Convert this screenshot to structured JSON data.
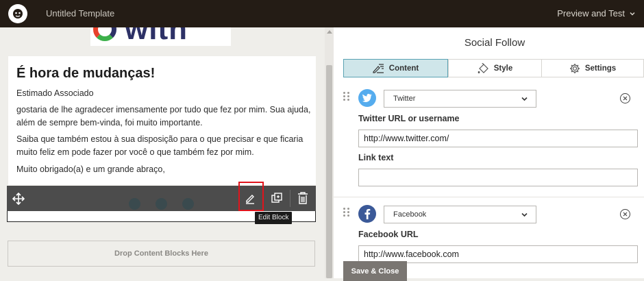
{
  "topbar": {
    "title": "Untitled Template",
    "preview_label": "Preview and Test"
  },
  "email": {
    "banner_text": "with",
    "heading": "É hora de mudanças!",
    "paragraphs": [
      "Estimado Associado",
      "gostaria de lhe agradecer imensamente por tudo que fez por mim. Sua ajuda, além de sempre bem-vinda, foi muito importante.",
      "Saiba que também estou à sua disposição para o que precisar e que ficaria muito feliz em pode fazer por você o que também fez por mim.",
      "Muito obrigado(a) e um grande abraço,"
    ],
    "tooltip": "Edit Block",
    "drop_zone": "Drop Content Blocks Here"
  },
  "panel": {
    "title": "Social Follow",
    "tabs": [
      {
        "label": "Content",
        "icon": "pencil-lines-icon",
        "active": true
      },
      {
        "label": "Style",
        "icon": "paint-bucket-icon",
        "active": false
      },
      {
        "label": "Settings",
        "icon": "gear-icon",
        "active": false
      }
    ],
    "items": [
      {
        "network": "Twitter",
        "icon": "twitter-bird-icon",
        "color": "#55acee",
        "url_label": "Twitter URL or username",
        "url_value": "http://www.twitter.com/",
        "link_label": "Link text",
        "link_value": ""
      },
      {
        "network": "Facebook",
        "icon": "facebook-f-icon",
        "color": "#3b5998",
        "url_label": "Facebook URL",
        "url_value": "http://www.facebook.com"
      }
    ],
    "save_label": "Save & Close"
  },
  "colors": {
    "topbar": "#241c15",
    "active_tab": "#cfe6ea",
    "highlight": "#e0141c"
  }
}
